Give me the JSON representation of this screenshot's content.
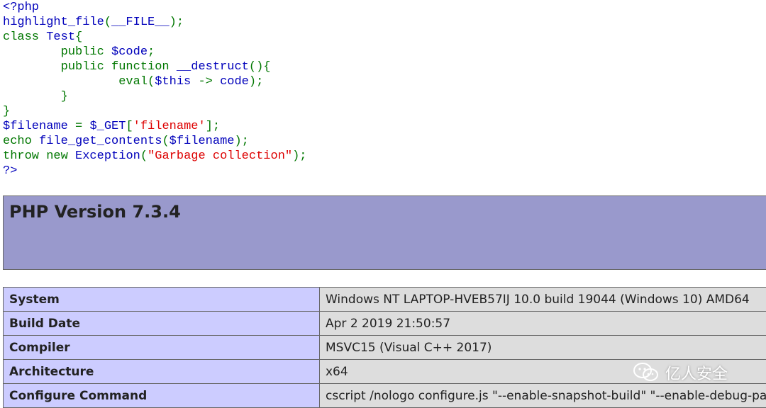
{
  "source": {
    "lines": [
      [
        {
          "t": "<?php",
          "c": "df"
        }
      ],
      [
        {
          "t": "highlight_file",
          "c": "df"
        },
        {
          "t": "(",
          "c": "kw"
        },
        {
          "t": "__FILE__",
          "c": "df"
        },
        {
          "t": ");",
          "c": "kw"
        }
      ],
      [
        {
          "t": "class ",
          "c": "kw"
        },
        {
          "t": "Test",
          "c": "df"
        },
        {
          "t": "{",
          "c": "kw"
        }
      ],
      [
        {
          "t": "        public ",
          "c": "kw"
        },
        {
          "t": "$code",
          "c": "df"
        },
        {
          "t": ";",
          "c": "kw"
        }
      ],
      [
        {
          "t": "        public function ",
          "c": "kw"
        },
        {
          "t": "__destruct",
          "c": "df"
        },
        {
          "t": "(){",
          "c": "kw"
        }
      ],
      [
        {
          "t": "                eval(",
          "c": "kw"
        },
        {
          "t": "$this",
          "c": "df"
        },
        {
          "t": " -> ",
          "c": "kw"
        },
        {
          "t": "code",
          "c": "df"
        },
        {
          "t": ");",
          "c": "kw"
        }
      ],
      [
        {
          "t": "        }",
          "c": "kw"
        }
      ],
      [
        {
          "t": "}",
          "c": "kw"
        }
      ],
      [
        {
          "t": "$filename ",
          "c": "df"
        },
        {
          "t": "= ",
          "c": "kw"
        },
        {
          "t": "$_GET",
          "c": "df"
        },
        {
          "t": "[",
          "c": "kw"
        },
        {
          "t": "'filename'",
          "c": "st"
        },
        {
          "t": "];",
          "c": "kw"
        }
      ],
      [
        {
          "t": "echo ",
          "c": "kw"
        },
        {
          "t": "file_get_contents",
          "c": "df"
        },
        {
          "t": "(",
          "c": "kw"
        },
        {
          "t": "$filename",
          "c": "df"
        },
        {
          "t": ");",
          "c": "kw"
        }
      ],
      [
        {
          "t": "throw new ",
          "c": "kw"
        },
        {
          "t": "Exception",
          "c": "df"
        },
        {
          "t": "(",
          "c": "kw"
        },
        {
          "t": "\"Garbage collection\"",
          "c": "st"
        },
        {
          "t": ");",
          "c": "kw"
        }
      ],
      [
        {
          "t": "?>",
          "c": "df"
        }
      ]
    ]
  },
  "phpinfo": {
    "title": "PHP Version 7.3.4",
    "rows": [
      {
        "label": "System",
        "value": "Windows NT LAPTOP-HVEB57IJ 10.0 build 19044 (Windows 10) AMD64"
      },
      {
        "label": "Build Date",
        "value": "Apr 2 2019 21:50:57"
      },
      {
        "label": "Compiler",
        "value": "MSVC15 (Visual C++ 2017)"
      },
      {
        "label": "Architecture",
        "value": "x64"
      },
      {
        "label": "Configure Command",
        "value": "cscript /nologo configure.js \"--enable-snapshot-build\" \"--enable-debug-pac"
      }
    ]
  },
  "watermark": {
    "text": "亿人安全",
    "icon": "wechat-icon"
  },
  "colors": {
    "keyword": "#007700",
    "default": "#0000BB",
    "string": "#DD0000",
    "header_bg": "#9999cc",
    "label_bg": "#ccccff",
    "value_bg": "#dddddd"
  }
}
